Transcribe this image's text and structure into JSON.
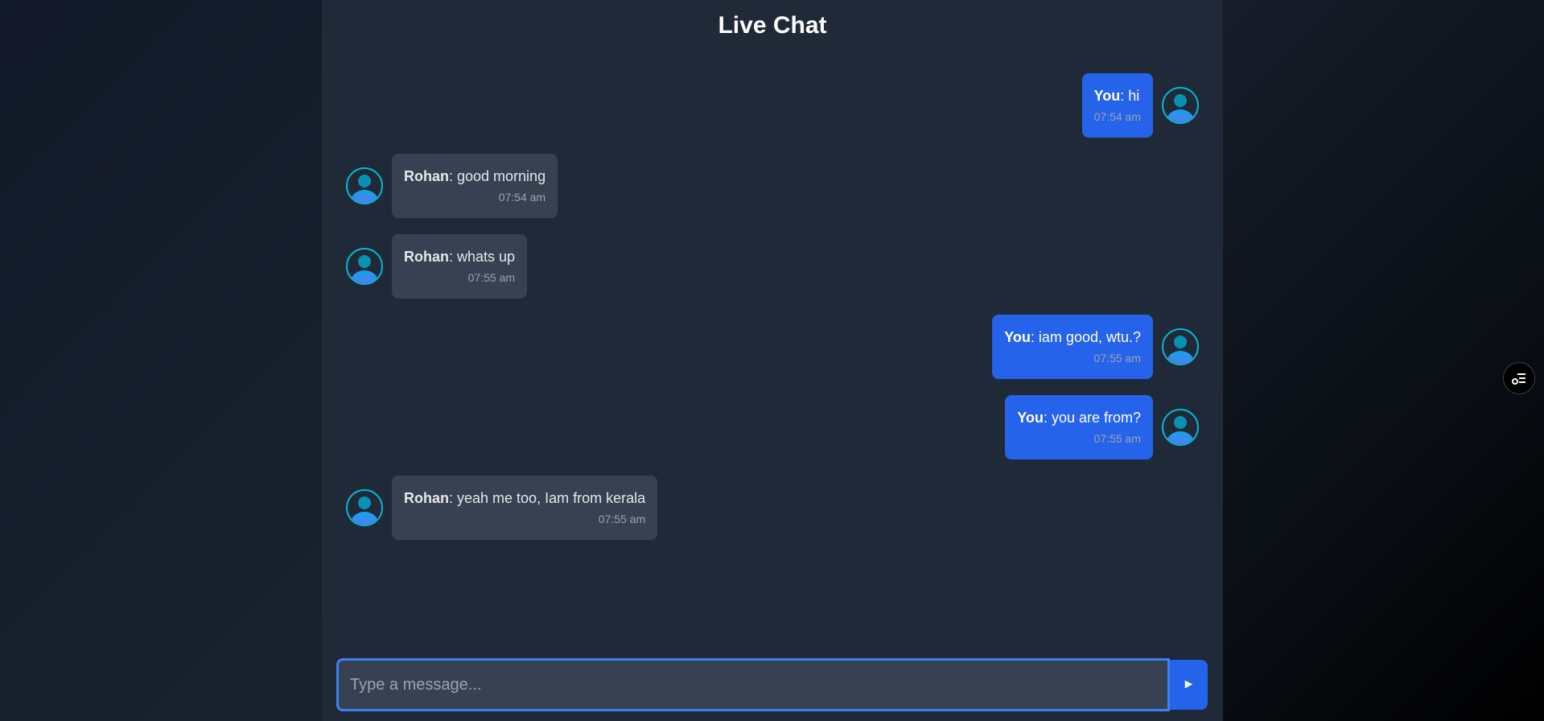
{
  "header": {
    "title": "Live Chat"
  },
  "messages": [
    {
      "direction": "sent",
      "sender": "You",
      "text": ": hi",
      "time": "07:54 am"
    },
    {
      "direction": "received",
      "sender": "Rohan",
      "text": ": good morning",
      "time": "07:54 am"
    },
    {
      "direction": "received",
      "sender": "Rohan",
      "text": ": whats up",
      "time": "07:55 am"
    },
    {
      "direction": "sent",
      "sender": "You",
      "text": ": iam good, wtu.?",
      "time": "07:55 am"
    },
    {
      "direction": "sent",
      "sender": "You",
      "text": ": you are from?",
      "time": "07:55 am"
    },
    {
      "direction": "received",
      "sender": "Rohan",
      "text": ": yeah me too, Iam from kerala",
      "time": "07:55 am"
    }
  ],
  "composer": {
    "placeholder": "Type a message...",
    "value": "",
    "send_icon": "►"
  },
  "icons": {
    "avatar": "user-avatar-icon",
    "send": "send-arrow-icon",
    "floating_tool": "settings-list-icon"
  },
  "colors": {
    "sent_bubble": "#2563eb",
    "received_bubble": "#374151",
    "panel": "#1f2937",
    "avatar_ring": "#06b6d4",
    "input_border": "#3b82f6"
  }
}
